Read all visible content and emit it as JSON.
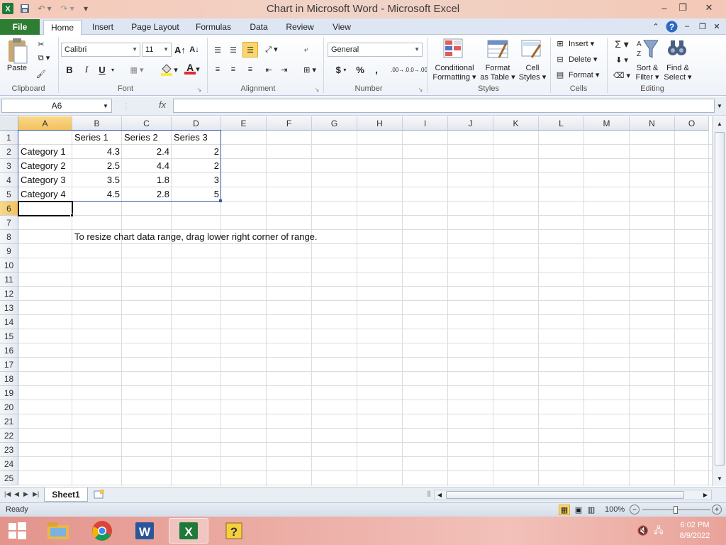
{
  "window": {
    "title": "Chart in Microsoft Word  -  Microsoft Excel",
    "minimize": "–",
    "restore": "❐",
    "close": "✕"
  },
  "ribbon": {
    "file_tab": "File",
    "tabs": [
      "Home",
      "Insert",
      "Page Layout",
      "Formulas",
      "Data",
      "Review",
      "View"
    ],
    "clipboard": {
      "label": "Clipboard",
      "paste": "Paste"
    },
    "font": {
      "label": "Font",
      "name": "Calibri",
      "size": "11",
      "bold": "B",
      "italic": "I",
      "underline": "U",
      "font_color_glyph": "A"
    },
    "alignment": {
      "label": "Alignment"
    },
    "number": {
      "label": "Number",
      "format": "General",
      "currency": "$",
      "percent": "%",
      "comma": ",",
      "inc_dec": ".00→.0",
      "dec_dec": ".0→.00"
    },
    "styles": {
      "label": "Styles",
      "conditional": [
        "Conditional",
        "Formatting ▾"
      ],
      "format_table": [
        "Format",
        "as Table ▾"
      ],
      "cell_styles": [
        "Cell",
        "Styles ▾"
      ]
    },
    "cells": {
      "label": "Cells",
      "insert": "Insert ▾",
      "delete": "Delete ▾",
      "format": "Format ▾"
    },
    "editing": {
      "label": "Editing",
      "sort_filter": [
        "Sort &",
        "Filter ▾"
      ],
      "find_select": [
        "Find &",
        "Select ▾"
      ]
    }
  },
  "formula_bar": {
    "name_box": "A6",
    "fx": "fx",
    "formula": ""
  },
  "columns": [
    "A",
    "B",
    "C",
    "D",
    "E",
    "F",
    "G",
    "H",
    "I",
    "J",
    "K",
    "L",
    "M",
    "N",
    "O"
  ],
  "rows": [
    "1",
    "2",
    "3",
    "4",
    "5",
    "6",
    "7",
    "8",
    "9",
    "10",
    "11",
    "12",
    "13",
    "14",
    "15",
    "16",
    "17",
    "18",
    "19",
    "20",
    "21",
    "22",
    "23",
    "24",
    "25"
  ],
  "sheet": {
    "headers": [
      "",
      "Series 1",
      "Series 2",
      "Series 3"
    ],
    "data": [
      [
        "Category 1",
        "4.3",
        "2.4",
        "2"
      ],
      [
        "Category 2",
        "2.5",
        "4.4",
        "2"
      ],
      [
        "Category 3",
        "3.5",
        "1.8",
        "3"
      ],
      [
        "Category 4",
        "4.5",
        "2.8",
        "5"
      ]
    ],
    "note": "To resize chart data range, drag lower right corner of range.",
    "active_cell": "A6"
  },
  "sheet_tabs": {
    "active": "Sheet1"
  },
  "status": {
    "text": "Ready",
    "zoom": "100%"
  },
  "taskbar": {
    "time": "6:02 PM",
    "date": "8/9/2022"
  }
}
